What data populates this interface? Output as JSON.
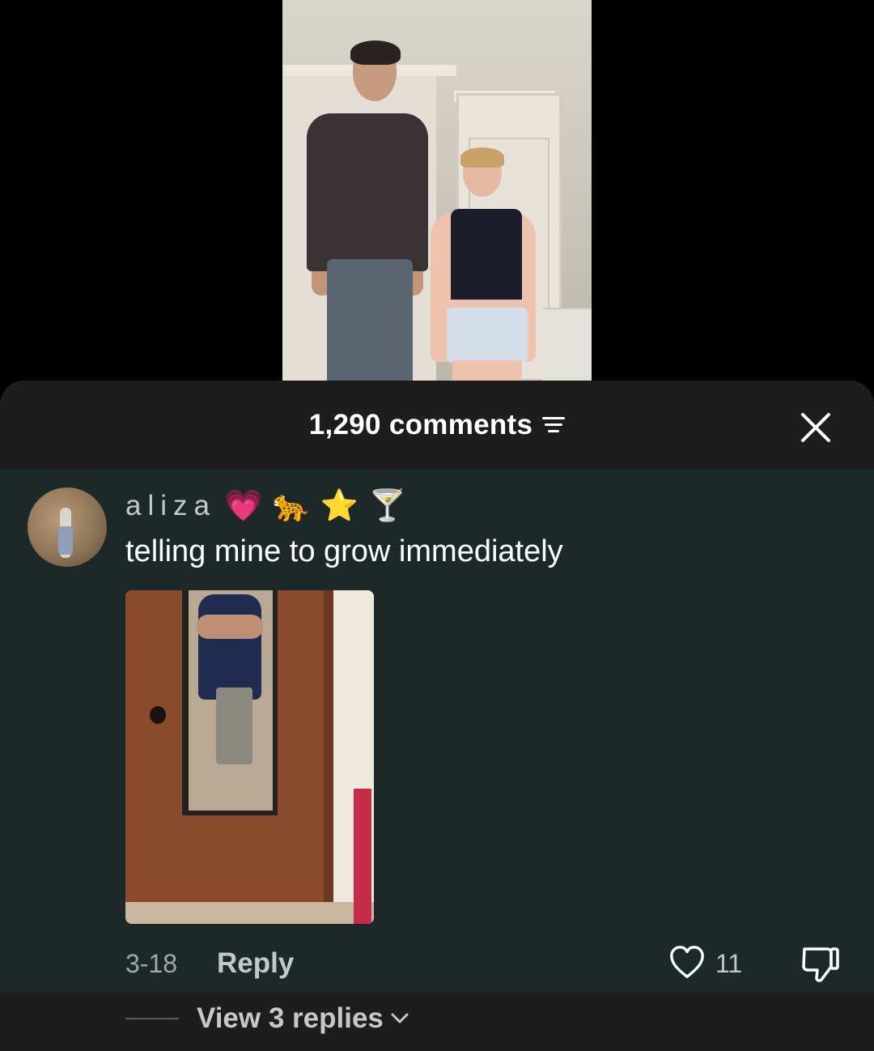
{
  "video": {
    "description_icon": "video-frame"
  },
  "comments": {
    "count_label": "1,290 comments",
    "filter_icon": "filter-icon",
    "close_icon": "close-icon"
  },
  "comment": {
    "username": "aliza",
    "username_emojis": [
      "💗",
      "🐆",
      "⭐",
      "🍸"
    ],
    "text": "telling mine to grow immediately",
    "date": "3-18",
    "reply_label": "Reply",
    "like_count": "11",
    "view_replies_label": "View 3 replies"
  },
  "colors": {
    "sheet_bg": "#1d2929",
    "header_bg": "#1d1d1e",
    "text_primary": "#ffffff",
    "text_secondary": "#a4a8a8"
  }
}
